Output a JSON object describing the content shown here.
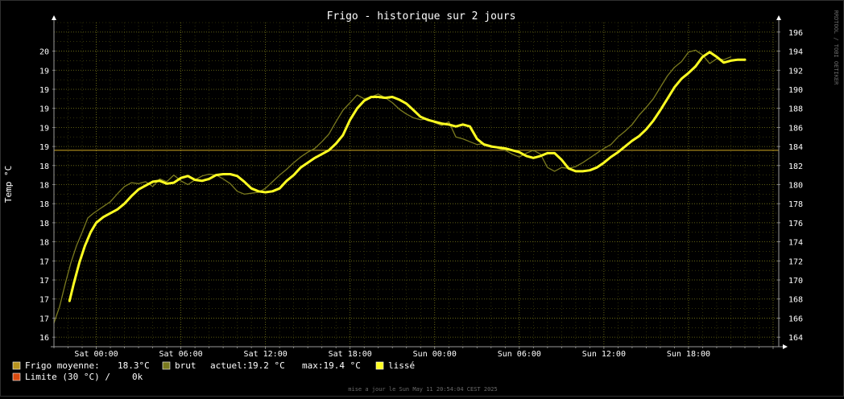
{
  "colors": {
    "background": "#000000",
    "grid": "#7a7a1a",
    "axis": "#9a9a9a",
    "text": "#ffffff",
    "raw": "#7a7a1e",
    "smooth": "#ffff22",
    "average": "#b8941e",
    "limit": "#d84a10"
  },
  "watermark": "RRDTOOL / TOBI OETIKER",
  "legend": {
    "average": {
      "label": "Frigo moyenne:",
      "value": "18.3°C"
    },
    "raw": {
      "label": "brut",
      "current": "actuel:19.2 °C",
      "max": "max:19.4 °C"
    },
    "smooth": {
      "label": "lissé"
    },
    "limit": {
      "label": "Limite (30 °C) /",
      "value": "0k"
    }
  },
  "footer": "mise a jour le Sun May 11 20:54:04 CEST 2025",
  "chart_data": {
    "type": "line",
    "title": "Frigo - historique sur 2 jours",
    "ylabel": "Temp °C",
    "x_tick_labels": [
      "Sat 00:00",
      "Sat 06:00",
      "Sat 12:00",
      "Sat 18:00",
      "Sun 00:00",
      "Sun 06:00",
      "Sun 12:00",
      "Sun 18:00"
    ],
    "x_tick_hours": [
      0,
      6,
      12,
      18,
      24,
      30,
      36,
      42
    ],
    "xlim_hours": [
      -3,
      48.4
    ],
    "left_tick_labels": [
      "16",
      "17",
      "17",
      "17",
      "17",
      "18",
      "18",
      "18",
      "18",
      "18",
      "19",
      "19",
      "19",
      "19",
      "19",
      "20"
    ],
    "right_axis": {
      "ylim": [
        163,
        197
      ],
      "ticks": [
        164,
        166,
        168,
        170,
        172,
        174,
        176,
        178,
        180,
        182,
        184,
        186,
        188,
        190,
        192,
        194,
        196
      ]
    },
    "average_line": 183.6,
    "grid": true,
    "series": [
      {
        "name": "brut",
        "x_hours": [
          -3,
          -2.6,
          -2.2,
          -1.8,
          -1.4,
          -1,
          -0.6,
          -0.2,
          0.4,
          1,
          1.6,
          2,
          2.5,
          3,
          3.5,
          4,
          4.5,
          5,
          5.5,
          6,
          6.5,
          7,
          7.5,
          8,
          8.5,
          9,
          9.5,
          10,
          10.5,
          11,
          11.5,
          12,
          12.5,
          13,
          13.5,
          14,
          14.5,
          15,
          15.5,
          16,
          16.5,
          17,
          17.5,
          18,
          18.5,
          19,
          19.5,
          20,
          20.5,
          21,
          21.5,
          22,
          22.5,
          23,
          23.5,
          24,
          24.5,
          25,
          25.5,
          26,
          26.5,
          27,
          27.5,
          28,
          28.5,
          29,
          29.5,
          30,
          30.5,
          31,
          31.5,
          32,
          32.5,
          33,
          33.5,
          34,
          34.5,
          35,
          35.5,
          36,
          36.5,
          37,
          37.5,
          38,
          38.5,
          39,
          39.5,
          40,
          40.5,
          41,
          41.5,
          42,
          42.5,
          43,
          43.5,
          44,
          44.5,
          45,
          45.5,
          46,
          46.5,
          47,
          47.5,
          48,
          48.2
        ],
        "values": [
          165.5,
          167.2,
          169.6,
          171.8,
          173.6,
          175.0,
          176.5,
          177.0,
          177.6,
          178.2,
          179.2,
          179.8,
          180.2,
          180.1,
          180.3,
          179.8,
          180.6,
          180.3,
          181.0,
          180.4,
          180.0,
          180.5,
          180.9,
          181.1,
          181.0,
          180.6,
          180.1,
          179.3,
          179.0,
          179.1,
          179.2,
          179.6,
          180.3,
          181.0,
          181.6,
          182.3,
          182.9,
          183.4,
          183.8,
          184.5,
          185.3,
          186.6,
          187.8,
          188.6,
          189.4,
          189.0,
          189.2,
          189.5,
          189.1,
          188.6,
          187.9,
          187.4,
          187.0,
          186.8,
          186.9,
          186.5,
          186.2,
          186.6,
          185.0,
          184.8,
          184.5,
          184.2,
          184.3,
          184.1,
          183.8,
          183.6,
          183.2,
          182.9,
          183.3,
          183.6,
          183.2,
          181.8,
          181.4,
          181.8,
          181.7,
          181.9,
          182.3,
          182.8,
          183.3,
          183.8,
          184.2,
          185.0,
          185.6,
          186.3,
          187.3,
          188.1,
          189.0,
          190.2,
          191.4,
          192.3,
          192.9,
          193.9,
          194.1,
          193.6,
          192.7,
          193.2,
          193.1,
          193.4
        ]
      },
      {
        "name": "lissé",
        "x_hours": [
          -1.9,
          -1.6,
          -1.2,
          -0.8,
          -0.4,
          0,
          0.5,
          1,
          1.5,
          2,
          2.5,
          3,
          3.5,
          4,
          4.5,
          5,
          5.5,
          6,
          6.5,
          7,
          7.5,
          8,
          8.5,
          9,
          9.5,
          10,
          10.5,
          11,
          11.5,
          12,
          12.5,
          13,
          13.5,
          14,
          14.5,
          15,
          15.5,
          16,
          16.5,
          17,
          17.5,
          18,
          18.5,
          19,
          19.5,
          20,
          20.5,
          21,
          21.5,
          22,
          22.5,
          23,
          23.5,
          24,
          24.5,
          25,
          25.5,
          26,
          26.5,
          27,
          27.5,
          28,
          28.5,
          29,
          29.5,
          30,
          30.5,
          31,
          31.5,
          32,
          32.5,
          33,
          33.5,
          34,
          34.5,
          35,
          35.5,
          36,
          36.5,
          37,
          37.5,
          38,
          38.5,
          39,
          39.5,
          40,
          40.5,
          41,
          41.5,
          42,
          42.5,
          43,
          43.5,
          44,
          44.5,
          45,
          45.5,
          46,
          46.5,
          47,
          47.5,
          48,
          48.2
        ],
        "values": [
          167.8,
          169.6,
          171.8,
          173.6,
          175.0,
          176.0,
          176.6,
          177.0,
          177.4,
          178.0,
          178.8,
          179.5,
          179.9,
          180.3,
          180.4,
          180.1,
          180.2,
          180.7,
          180.9,
          180.5,
          180.4,
          180.6,
          181.0,
          181.1,
          181.1,
          180.9,
          180.3,
          179.6,
          179.3,
          179.2,
          179.3,
          179.6,
          180.4,
          181.0,
          181.8,
          182.3,
          182.8,
          183.2,
          183.6,
          184.3,
          185.2,
          186.8,
          188.0,
          188.8,
          189.2,
          189.2,
          189.1,
          189.2,
          188.9,
          188.5,
          187.8,
          187.1,
          186.8,
          186.6,
          186.4,
          186.3,
          186.1,
          186.3,
          186.1,
          184.8,
          184.2,
          184.0,
          183.9,
          183.8,
          183.6,
          183.4,
          183.0,
          182.8,
          183.0,
          183.3,
          183.3,
          182.6,
          181.7,
          181.4,
          181.4,
          181.5,
          181.8,
          182.3,
          182.9,
          183.4,
          184.0,
          184.6,
          185.1,
          185.8,
          186.7,
          187.8,
          189.0,
          190.2,
          191.1,
          191.7,
          192.4,
          193.4,
          193.9,
          193.4,
          192.8,
          193.0,
          193.1,
          193.1
        ]
      }
    ]
  }
}
